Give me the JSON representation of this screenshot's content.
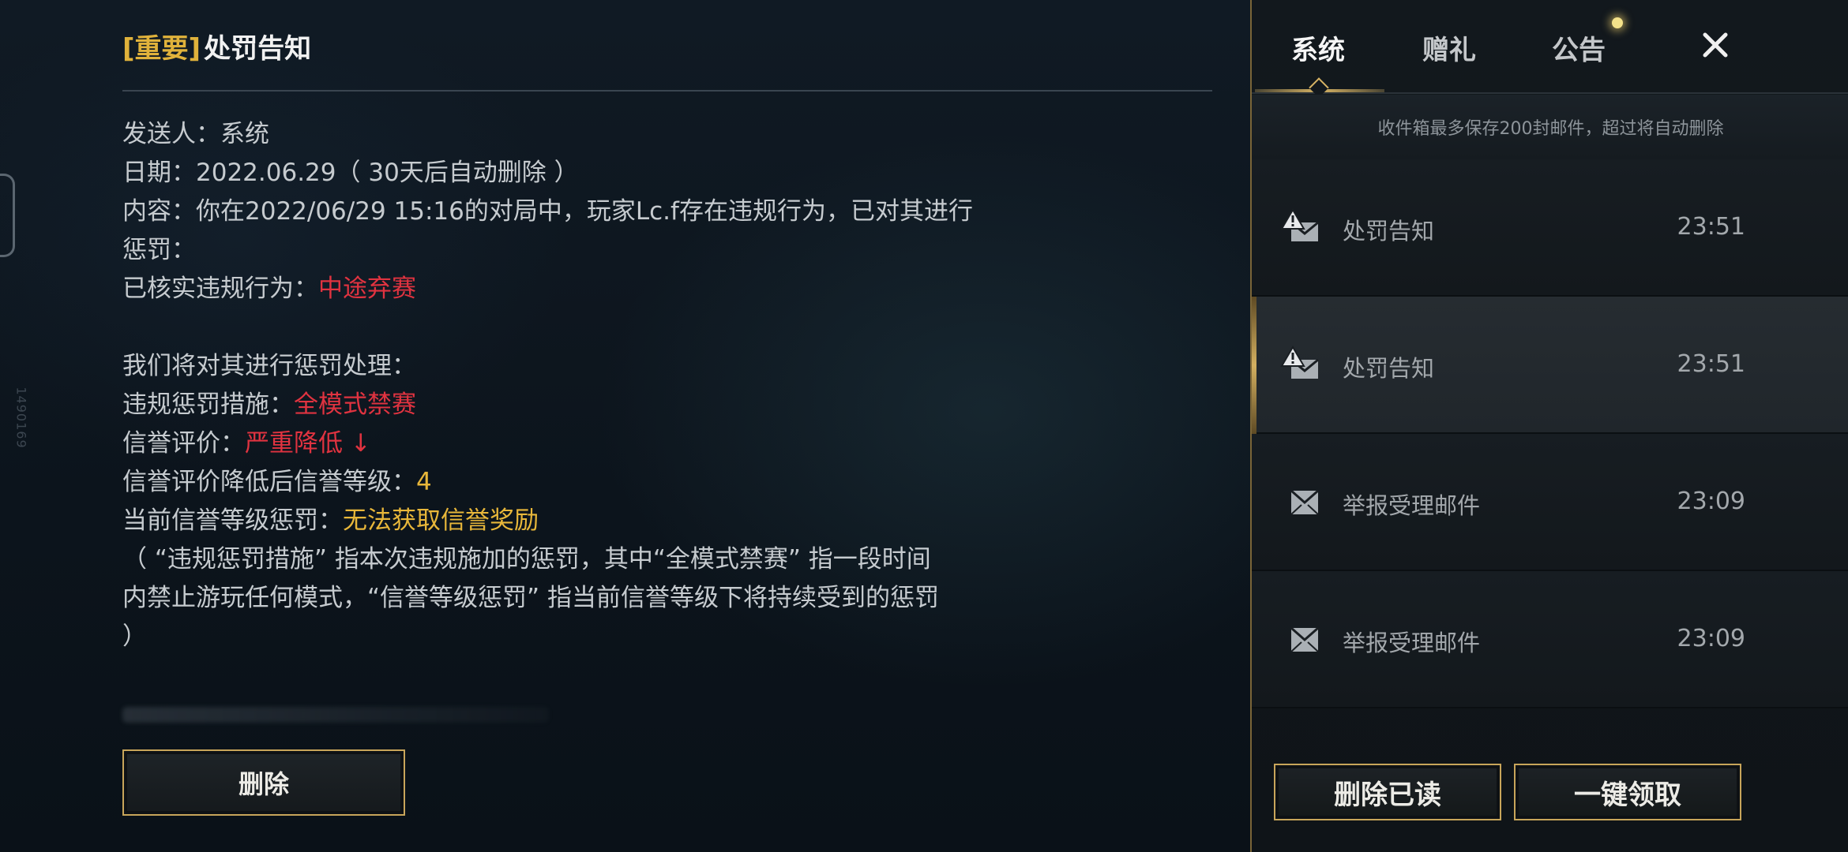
{
  "side_id": "1490169",
  "detail": {
    "title_tag": "[重要]",
    "title": "处罚告知",
    "sender_label": "发送人：",
    "sender_value": "系统",
    "date_label": "日期：",
    "date_value": "2022.06.29（ 30天后自动删除 ）",
    "content_line1": "内容：你在2022/06/29 15:16的对局中，玩家Lc.f存在违规行为，已对其进行",
    "content_line2": "惩罚：",
    "verified_label": "已核实违规行为：",
    "verified_value": "中途弃赛",
    "process_intro": "我们将对其进行惩罚处理：",
    "measure_label": "违规惩罚措施：",
    "measure_value": "全模式禁赛",
    "credit_label": "信誉评价：",
    "credit_value": "严重降低 ↓",
    "level_label": "信誉评价降低后信誉等级：",
    "level_value": "4",
    "current_penalty_label": "当前信誉等级惩罚：",
    "current_penalty_value": "无法获取信誉奖励",
    "note_line1": "（ “违规惩罚措施” 指本次违规施加的惩罚，其中“全模式禁赛” 指一段时间",
    "note_line2": "内禁止游玩任何模式，“信誉等级惩罚” 指当前信誉等级下将持续受到的惩罚",
    "note_line3": "）",
    "delete_button": "删除"
  },
  "panel": {
    "tabs": [
      {
        "label": "系统",
        "active": true
      },
      {
        "label": "赠礼",
        "active": false
      },
      {
        "label": "公告",
        "active": false
      }
    ],
    "info": "收件箱最多保存200封邮件，超过将自动删除",
    "mails": [
      {
        "icon": "warning-mail-icon",
        "title": "处罚告知",
        "time": "23:51",
        "selected": false
      },
      {
        "icon": "warning-mail-icon",
        "title": "处罚告知",
        "time": "23:51",
        "selected": true
      },
      {
        "icon": "mail-icon",
        "title": "举报受理邮件",
        "time": "23:09",
        "selected": false
      },
      {
        "icon": "mail-icon",
        "title": "举报受理邮件",
        "time": "23:09",
        "selected": false
      }
    ],
    "delete_read_button": "删除已读",
    "claim_all_button": "一键领取"
  },
  "colors": {
    "accent_gold": "#c8a55a",
    "tag_yellow": "#e0b23b",
    "highlight_red": "#e03340",
    "highlight_yellow": "#e8b73a"
  }
}
